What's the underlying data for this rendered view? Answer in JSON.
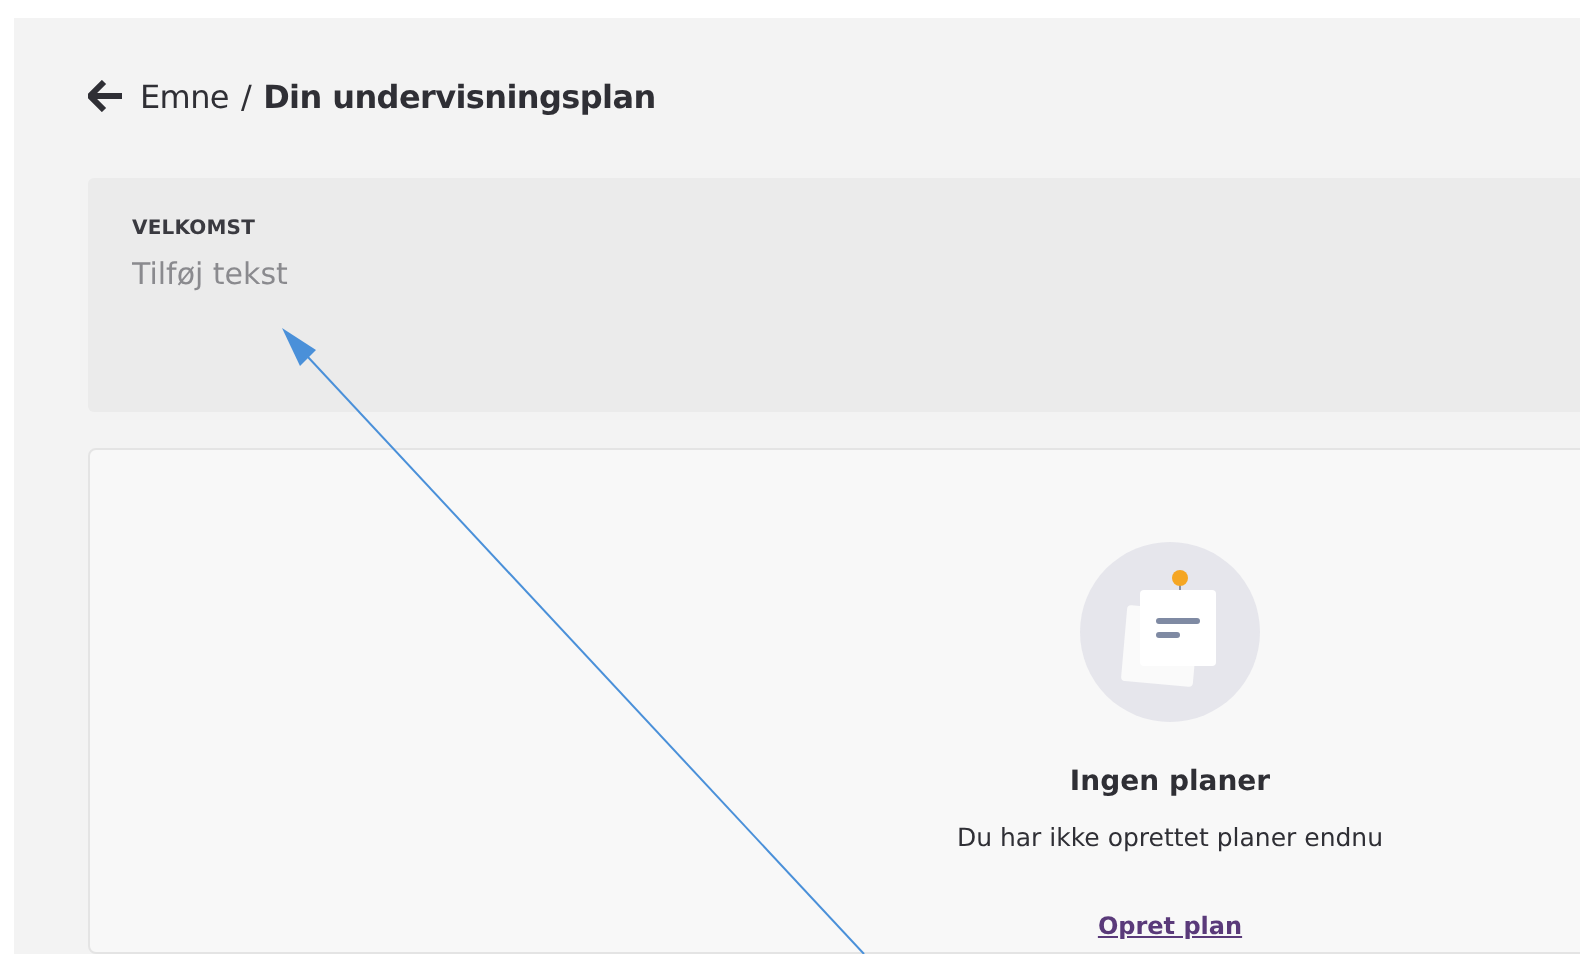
{
  "breadcrumb": {
    "parent": "Emne",
    "separator": "/",
    "current": "Din undervisningsplan"
  },
  "welcome": {
    "label": "VELKOMST",
    "placeholder": "Tilføj tekst"
  },
  "empty_state": {
    "title": "Ingen planer",
    "message": "Du har ikke oprettet planer endnu",
    "link": "Opret plan"
  }
}
